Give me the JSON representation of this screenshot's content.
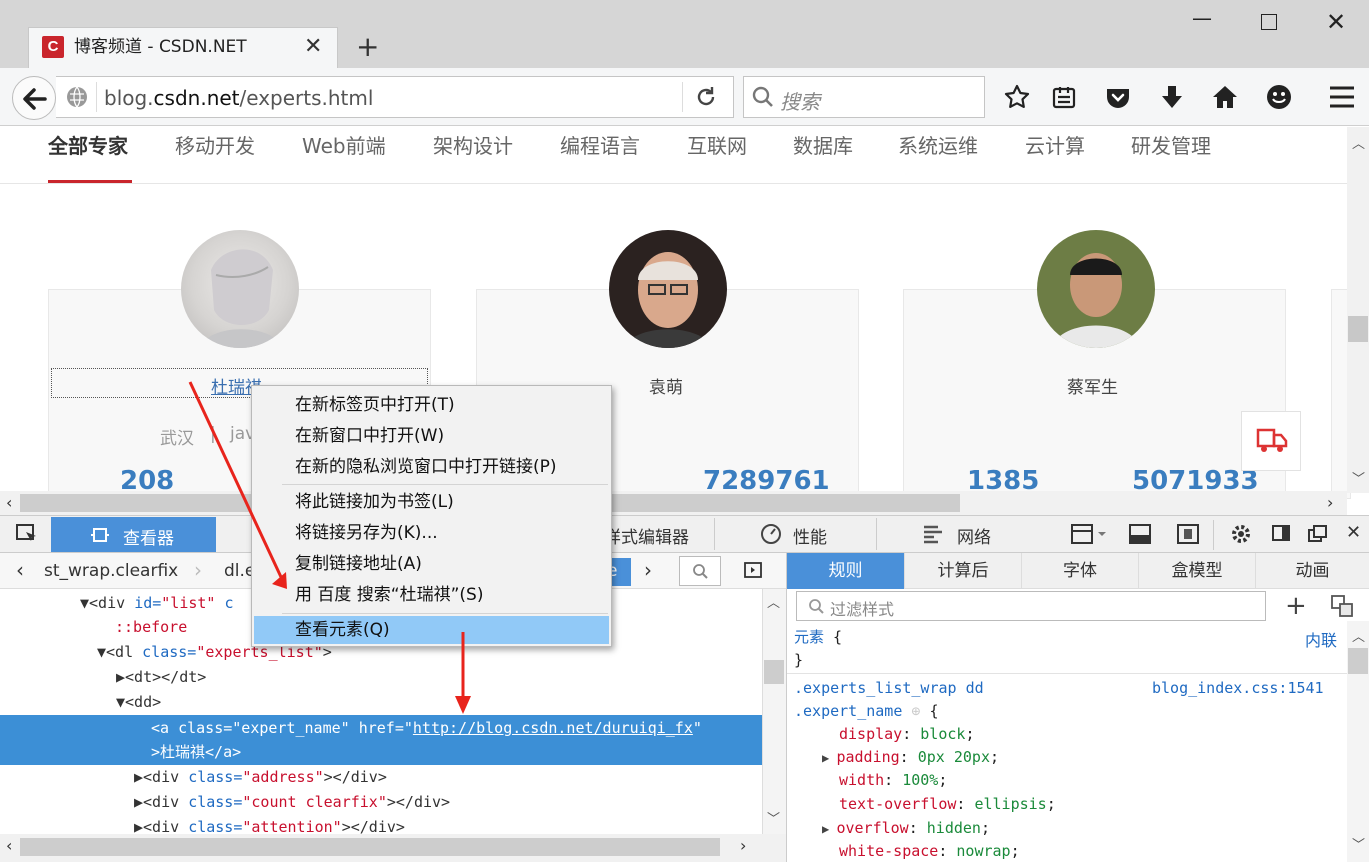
{
  "browser": {
    "tab_title": "博客频道 - CSDN.NET",
    "tab_icon_letter": "C",
    "url_prefix": "blog.",
    "url_domain": "csdn.net",
    "url_path": "/experts.html",
    "search_placeholder": "搜索"
  },
  "page": {
    "categories": [
      "全部专家",
      "移动开发",
      "Web前端",
      "架构设计",
      "编程语言",
      "互联网",
      "数据库",
      "系统运维",
      "云计算",
      "研发管理"
    ],
    "experts": [
      {
        "name": "杜瑞祺",
        "location": "武汉",
        "tag": "jav",
        "stat1": "208",
        "stat2": ""
      },
      {
        "name": "袁萌",
        "stat1": "",
        "stat2": "7289761"
      },
      {
        "name": "蔡军生",
        "stat1": "1385",
        "stat2": "5071933"
      }
    ]
  },
  "devtools": {
    "tabs": {
      "inspector": "查看器",
      "style_editor": "样式编辑器",
      "performance": "性能",
      "network": "网络"
    },
    "crumbs": [
      "st_wrap.clearfix",
      "dl.e",
      "e"
    ],
    "markup": {
      "l1_tag": "<div ",
      "l1_attr": "id=",
      "l1_val": "\"list\"",
      "l1_tail": " c",
      "l2": "::before",
      "l3_tag": "<dl ",
      "l3_attr": "class=",
      "l3_val": "\"experts_list\"",
      "l3_tail": ">",
      "l4": "<dt></dt>",
      "l5": "<dd>",
      "l6": "<a class=\"expert_name\" href=\"",
      "l6_link": "http://blog.csdn.net/duruiqi_fx",
      "l6_end": "\"",
      "l7": ">杜瑞祺</a>",
      "l8_a": "<div ",
      "l8_b": "class=",
      "l8_c": "\"address\"",
      "l8_d": "></div>",
      "l9_a": "<div ",
      "l9_b": "class=",
      "l9_c": "\"count clearfix\"",
      "l9_d": "></div>",
      "l10_a": "<div ",
      "l10_b": "class=",
      "l10_c": "\"attention\"",
      "l10_d": "></div>"
    },
    "rule_tabs": [
      "规则",
      "计算后",
      "字体",
      "盒模型",
      "动画"
    ],
    "filter_placeholder": "过滤样式",
    "rules": {
      "element_sel": "元素",
      "element_open": " {",
      "element_close": "}",
      "inline_label": "内联",
      "sel1": ".experts_list_wrap dd",
      "sel2": ".expert_name",
      "brace": " {",
      "source": "blog_index.css:1541",
      "decls": [
        {
          "prop": "display",
          "val": "block"
        },
        {
          "prop": "padding",
          "val": "0px 20px"
        },
        {
          "prop": "width",
          "val": "100%"
        },
        {
          "prop": "text-overflow",
          "val": "ellipsis"
        },
        {
          "prop": "overflow",
          "val": "hidden"
        },
        {
          "prop": "white-space",
          "val": "nowrap"
        }
      ]
    }
  },
  "context_menu": {
    "items": [
      "在新标签页中打开(T)",
      "在新窗口中打开(W)",
      "在新的隐私浏览窗口中打开链接(P)",
      "将此链接加为书签(L)",
      "将链接另存为(K)...",
      "复制链接地址(A)",
      "用 百度 搜索“杜瑞祺”(S)",
      "查看元素(Q)"
    ]
  },
  "colors": {
    "accent_red": "#c9252c",
    "devtools_blue": "#4a90d9",
    "link_blue": "#3a7dbf"
  }
}
